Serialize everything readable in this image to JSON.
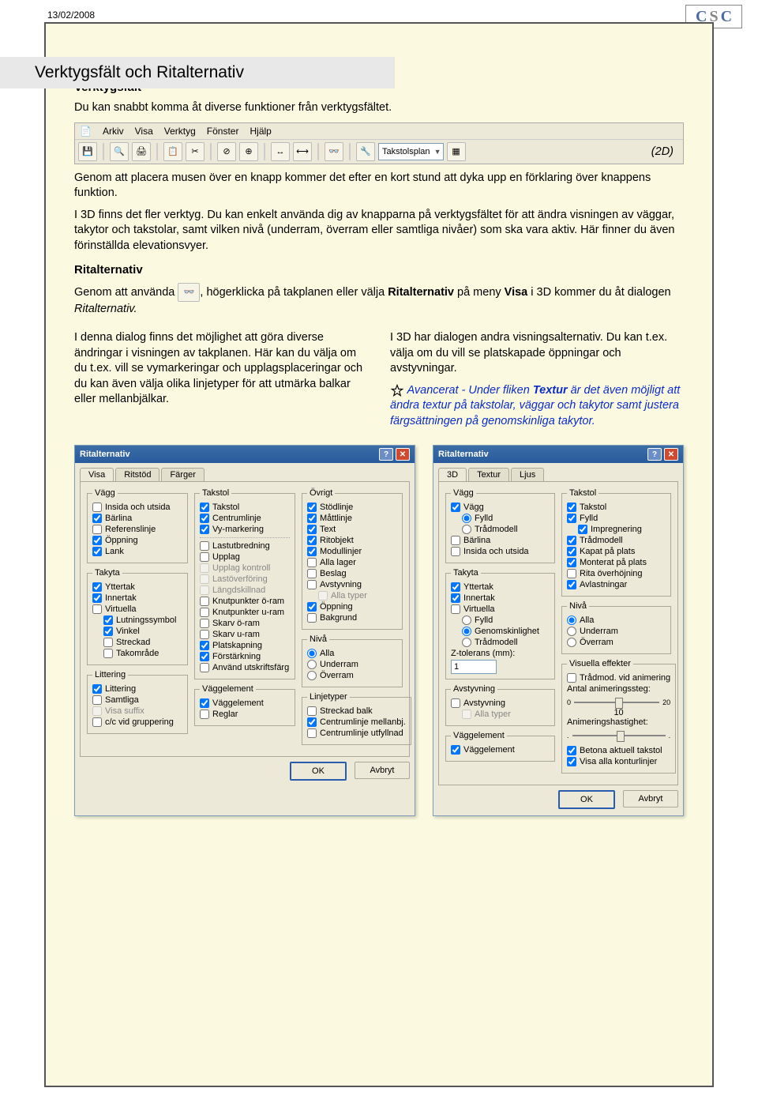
{
  "header": {
    "date": "13/02/2008",
    "logo_letters": [
      "C",
      "S",
      "C"
    ]
  },
  "title": "Verktygsfält och Ritalternativ",
  "s1": {
    "heading": "Verktygsfält",
    "p1": "Du kan snabbt komma åt diverse funktioner från verktygsfältet.",
    "trailing_2d": "(2D)",
    "p2": "Genom att placera musen över en knapp kommer det efter en kort stund att dyka upp en förklaring över knappens funktion.",
    "p3": "I 3D finns det fler verktyg. Du kan enkelt använda dig av knapparna på verktygsfältet för att ändra visningen av väggar, takytor och takstolar, samt vilken nivå (underram, överram eller samtliga nivåer) som ska vara aktiv. Här finner du även förinställda elevationsvyer."
  },
  "toolbar": {
    "menu": [
      "Arkiv",
      "Visa",
      "Verktyg",
      "Fönster",
      "Hjälp"
    ],
    "combo": "Takstolsplan"
  },
  "s2": {
    "heading": "Ritalternativ",
    "line_pre": "Genom att använda",
    "line_post": ", högerklicka på takplanen eller välja ",
    "bold1": "Ritalternativ",
    "mid": " på meny ",
    "bold2": "Visa",
    "line_end": " i 3D kommer du åt dialogen ",
    "ital": "Ritalternativ.",
    "left": "I denna dialog finns det möjlighet att göra diverse ändringar i visningen av takplanen. Här kan du välja om du t.ex. vill se vymarkeringar och upplagsplaceringar och du kan även välja olika linjetyper för att utmärka balkar eller mellanbjälkar.",
    "right_p": "I 3D har dialogen andra visningsalternativ. Du kan t.ex. välja om du vill se platskapade öppningar och avstyvningar.",
    "adv_pre": " Avancerat - Under fliken ",
    "adv_bold": "Textur",
    "adv_post": " är det även möjligt att ändra textur på takstolar, väggar och takytor samt justera färgsättningen på genomskinliga takytor."
  },
  "dlg": {
    "title": "Ritalternativ",
    "tabs_a": [
      "Visa",
      "Ritstöd",
      "Färger"
    ],
    "tabs_b": [
      "3D",
      "Textur",
      "Ljus"
    ],
    "ok": "OK",
    "cancel": "Avbryt",
    "a": {
      "g_vagg": "Vägg",
      "vagg": [
        {
          "t": "Insida och utsida",
          "c": false
        },
        {
          "t": "Bärlina",
          "c": true
        },
        {
          "t": "Referenslinje",
          "c": false
        },
        {
          "t": "Öppning",
          "c": true
        },
        {
          "t": "Lank",
          "c": true
        }
      ],
      "g_takyta": "Takyta",
      "takyta": [
        {
          "t": "Yttertak",
          "c": true
        },
        {
          "t": "Innertak",
          "c": true
        },
        {
          "t": "Virtuella",
          "c": false
        }
      ],
      "takyta_sub": [
        {
          "t": "Lutningssymbol",
          "c": true
        },
        {
          "t": "Vinkel",
          "c": true
        },
        {
          "t": "Streckad",
          "c": false
        },
        {
          "t": "Takområde",
          "c": false
        }
      ],
      "g_litt": "Littering",
      "litt": [
        {
          "t": "Littering",
          "c": true
        },
        {
          "t": "Samtliga",
          "c": false
        },
        {
          "t": "Visa suffix",
          "c": false,
          "d": true
        },
        {
          "t": "c/c vid gruppering",
          "c": false
        }
      ],
      "g_takstol": "Takstol",
      "takstol": [
        {
          "t": "Takstol",
          "c": true
        },
        {
          "t": "Centrumlinje",
          "c": true
        },
        {
          "t": "Vy-markering",
          "c": true
        }
      ],
      "takstol2": [
        {
          "t": "Lastutbredning",
          "c": false
        },
        {
          "t": "Upplag",
          "c": false
        },
        {
          "t": "Upplag kontroll",
          "c": false,
          "d": true
        },
        {
          "t": "Lastöverföring",
          "c": false,
          "d": true
        },
        {
          "t": "Längdskillnad",
          "c": false,
          "d": true
        },
        {
          "t": "Knutpunkter ö-ram",
          "c": false
        },
        {
          "t": "Knutpunkter u-ram",
          "c": false
        },
        {
          "t": "Skarv ö-ram",
          "c": false
        },
        {
          "t": "Skarv u-ram",
          "c": false
        },
        {
          "t": "Platskapning",
          "c": true
        },
        {
          "t": "Förstärkning",
          "c": true
        },
        {
          "t": "Använd utskriftsfärg",
          "c": false
        }
      ],
      "g_vaggel": "Väggelement",
      "vaggel": [
        {
          "t": "Väggelement",
          "c": true
        },
        {
          "t": "Reglar",
          "c": false
        }
      ],
      "g_ovr": "Övrigt",
      "ovr": [
        {
          "t": "Stödlinje",
          "c": true
        },
        {
          "t": "Måttlinje",
          "c": true
        },
        {
          "t": "Text",
          "c": true
        },
        {
          "t": "Ritobjekt",
          "c": true
        },
        {
          "t": "Modullinjer",
          "c": true
        },
        {
          "t": "Alla lager",
          "c": false
        },
        {
          "t": "Beslag",
          "c": false
        },
        {
          "t": "Avstyvning",
          "c": false
        },
        {
          "t": "Alla typer",
          "c": false,
          "d": true,
          "sub": true
        },
        {
          "t": "Öppning",
          "c": true
        },
        {
          "t": "Bakgrund",
          "c": false
        }
      ],
      "g_niva": "Nivå",
      "niva": [
        {
          "t": "Alla",
          "c": true
        },
        {
          "t": "Underram",
          "c": false
        },
        {
          "t": "Överram",
          "c": false
        }
      ],
      "g_lt": "Linjetyper",
      "lt": [
        {
          "t": "Streckad balk",
          "c": false
        },
        {
          "t": "Centrumlinje mellanbj.",
          "c": true
        },
        {
          "t": "Centrumlinje utfyllnad",
          "c": false
        }
      ]
    },
    "b": {
      "g_vagg": "Vägg",
      "vagg": [
        {
          "t": "Vägg",
          "c": true
        }
      ],
      "vagg_r": [
        {
          "t": "Fylld",
          "c": true
        },
        {
          "t": "Trådmodell",
          "c": false
        }
      ],
      "vagg2": [
        {
          "t": "Bärlina",
          "c": false
        },
        {
          "t": "Insida och utsida",
          "c": false
        }
      ],
      "g_takyta": "Takyta",
      "takyta": [
        {
          "t": "Yttertak",
          "c": true
        },
        {
          "t": "Innertak",
          "c": true
        },
        {
          "t": "Virtuella",
          "c": false
        }
      ],
      "takyta_r": [
        {
          "t": "Fylld",
          "c": false
        },
        {
          "t": "Genomskinlighet",
          "c": true
        },
        {
          "t": "Trådmodell",
          "c": false
        }
      ],
      "ztol_label": "Z-tolerans (mm):",
      "ztol": "1",
      "g_avs": "Avstyvning",
      "avs": [
        {
          "t": "Avstyvning",
          "c": false
        },
        {
          "t": "Alla typer",
          "c": false,
          "d": true,
          "sub": true
        }
      ],
      "g_vaggel": "Väggelement",
      "vaggel": [
        {
          "t": "Väggelement",
          "c": true
        }
      ],
      "g_takstol": "Takstol",
      "takstol": [
        {
          "t": "Takstol",
          "c": true
        },
        {
          "t": "Fylld",
          "c": true
        }
      ],
      "takstol_sub": [
        {
          "t": "Impregnering",
          "c": true,
          "sub": true
        }
      ],
      "takstol2": [
        {
          "t": "Trådmodell",
          "c": true
        },
        {
          "t": "Kapat på plats",
          "c": true
        },
        {
          "t": "Monterat på plats",
          "c": true
        },
        {
          "t": "Rita överhöjning",
          "c": false
        },
        {
          "t": "Avlastningar",
          "c": true
        }
      ],
      "g_niva": "Nivå",
      "niva": [
        {
          "t": "Alla",
          "c": true
        },
        {
          "t": "Underram",
          "c": false
        },
        {
          "t": "Överram",
          "c": false
        }
      ],
      "g_vis": "Visuella effekter",
      "vis": [
        {
          "t": "Trådmod. vid animering",
          "c": false
        }
      ],
      "st_label": "Antal animeringssteg:",
      "st_vals": [
        "0",
        "10",
        "20"
      ],
      "sp_label": "Animeringshastighet:",
      "sp_vals": [
        ".",
        ".",
        "."
      ],
      "vis2": [
        {
          "t": "Betona aktuell takstol",
          "c": true
        },
        {
          "t": "Visa alla konturlinjer",
          "c": true
        }
      ]
    }
  }
}
